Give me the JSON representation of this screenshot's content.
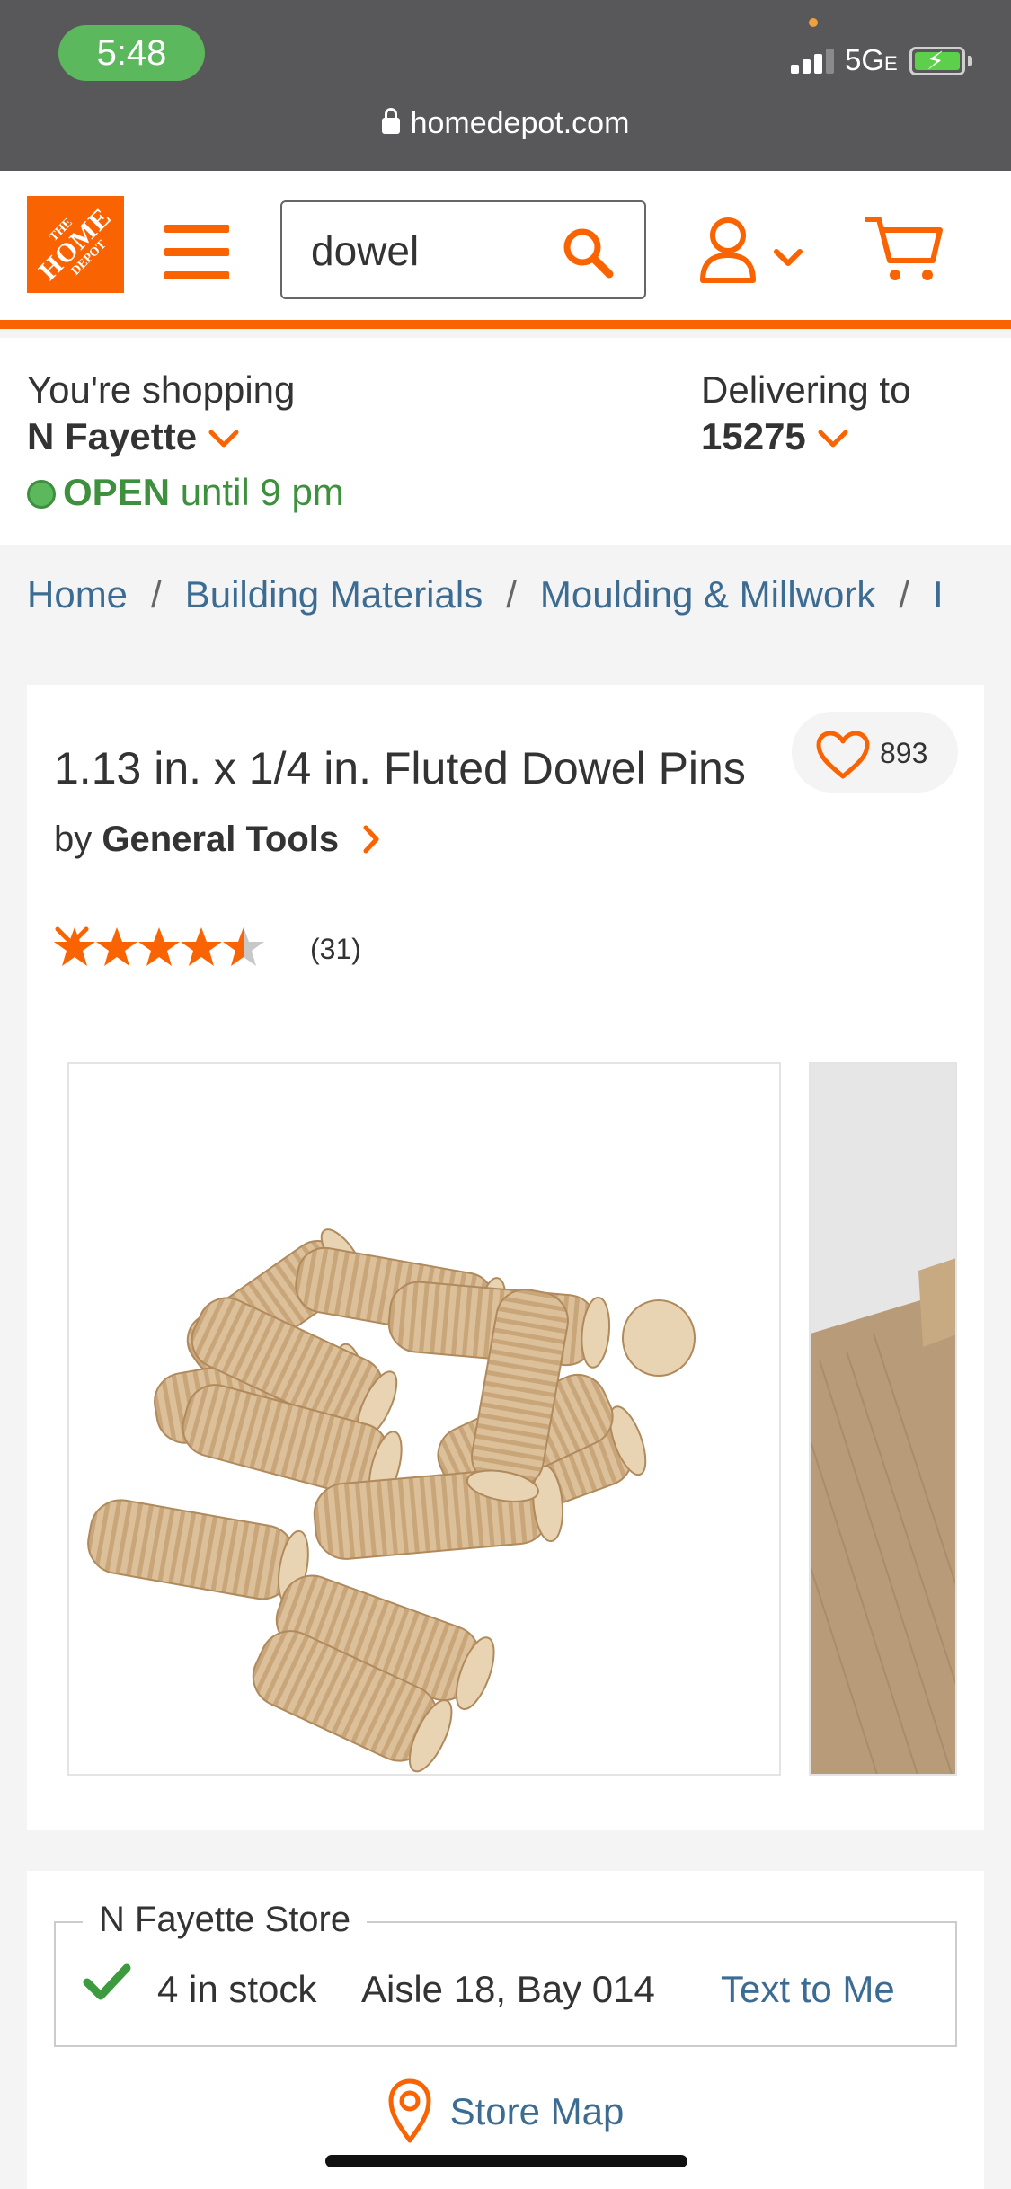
{
  "status_bar": {
    "time": "5:48",
    "network": "5G",
    "network_suffix": "E",
    "url": "homedepot.com"
  },
  "header": {
    "logo": {
      "line1": "THE",
      "line2": "HOME",
      "line3": "DEPOT"
    },
    "search_value": "dowel",
    "icons": [
      "menu-icon",
      "search-icon",
      "account-icon",
      "chevron-down-icon",
      "cart-icon"
    ],
    "accent_color": "#f96302"
  },
  "store_bar": {
    "shopping_label": "You're shopping",
    "store_name": "N Fayette",
    "open_status": "OPEN",
    "open_hours": "until 9 pm",
    "delivering_label": "Delivering to",
    "zip": "15275"
  },
  "breadcrumb": {
    "items": [
      "Home",
      "Building Materials",
      "Moulding & Millwork",
      "I"
    ],
    "separator": "/"
  },
  "product": {
    "title": "1.13 in. x 1/4 in. Fluted Dowel Pins",
    "brand_prefix": "by",
    "brand": "General Tools",
    "favorites_count": "893",
    "rating": 4.5,
    "rating_max": 5,
    "review_count": "(31)",
    "star_color": "#f96302"
  },
  "store_stock": {
    "store_label": "N Fayette Store",
    "stock": "4 in stock",
    "location": "Aisle 18, Bay 014",
    "text_link": "Text to Me",
    "map_link": "Store Map",
    "link_color": "#3d6c93"
  }
}
